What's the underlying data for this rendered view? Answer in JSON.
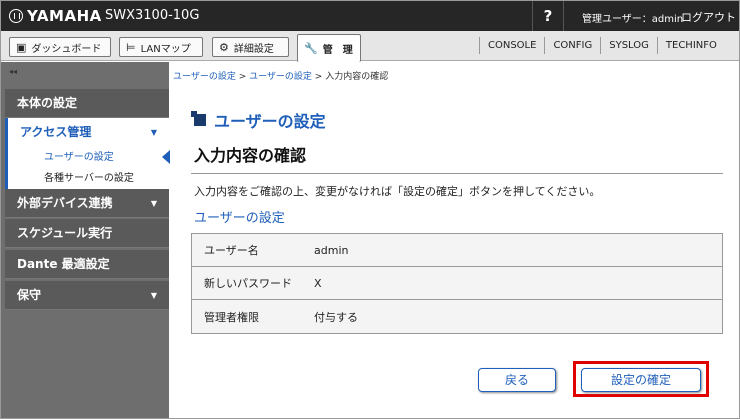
{
  "app": {
    "brand": "YAMAHA",
    "model": "SWX3100-10G",
    "help": "?",
    "user_info": "管理ユーザー：admin",
    "logout": "ログアウト"
  },
  "nav": {
    "tabs": [
      {
        "label": "ダッシュボード",
        "icon": "dashboard-icon"
      },
      {
        "label": "LANマップ",
        "icon": "lanmap-icon"
      },
      {
        "label": "詳細設定",
        "icon": "gear-icon"
      },
      {
        "label": "管　理",
        "icon": "wrench-icon"
      }
    ],
    "links": [
      "CONSOLE",
      "CONFIG",
      "SYSLOG",
      "TECHINFO"
    ]
  },
  "sidebar": {
    "collapse": "◂◂",
    "items": [
      {
        "label": "本体の設定"
      },
      {
        "label": "アクセス管理",
        "arrow": "▼"
      },
      {
        "label": "ユーザーの設定"
      },
      {
        "label": "各種サーバーの設定"
      },
      {
        "label": "外部デバイス連携",
        "arrow": "▼"
      },
      {
        "label": "スケジュール実行"
      },
      {
        "label": "Dante 最適設定"
      },
      {
        "label": "保守",
        "arrow": "▼"
      }
    ]
  },
  "breadcrumb": {
    "link1": "ユーザーの設定",
    "sep": " > ",
    "link2": "ユーザーの設定",
    "current": "入力内容の確認"
  },
  "main": {
    "title": "ユーザーの設定",
    "subtitle": "入力内容の確認",
    "message": "入力内容をご確認の上、変更がなければ「設定の確定」ボタンを押してください。",
    "section_title": "ユーザーの設定",
    "rows": [
      {
        "label": "ユーザー名",
        "value": "admin"
      },
      {
        "label": "新しいパスワード",
        "value": "X"
      },
      {
        "label": "管理者権限",
        "value": "付与する"
      }
    ],
    "back_button": "戻る",
    "confirm_button": "設定の確定"
  },
  "colors": {
    "accent": "#1f5fb9",
    "highlight": "#e00000",
    "topbar": "#262626",
    "sidebar": "#6e6e6e"
  }
}
